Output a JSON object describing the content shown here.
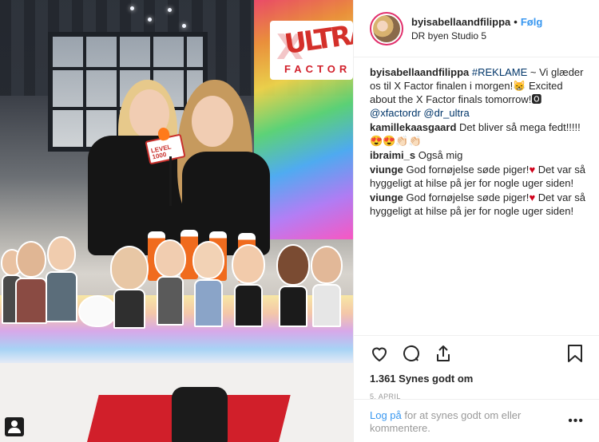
{
  "post": {
    "username": "byisabellaandfilippa",
    "separator": "•",
    "follow_label": "Følg",
    "location": "DR byen Studio 5"
  },
  "photo": {
    "banner_letters": "ULTRA",
    "banner_sub": "FACTOR",
    "sign_text": "LEVEL 1000"
  },
  "comments": [
    {
      "user": "byisabellaandfilippa",
      "parts": [
        {
          "text": " "
        },
        {
          "text": "#REKLAME",
          "link": true
        },
        {
          "text": " ~ Vi glæder os til X Factor finalen i morgen!😸 Excited about the X Factor finals tomorrow!"
        },
        {
          "text": "🅾",
          "emoji_box": true
        },
        {
          "text": " "
        },
        {
          "text": "@xfactordr",
          "link": true
        },
        {
          "text": " "
        },
        {
          "text": "@dr_ultra",
          "link": true
        }
      ]
    },
    {
      "user": "kamillekaasgaard",
      "parts": [
        {
          "text": " Det bliver så mega fedt!!!!! "
        },
        {
          "text": "😍😍👏🏻👏🏻",
          "emojis": true
        }
      ]
    },
    {
      "user": "ibraimi_s",
      "parts": [
        {
          "text": " Også mig"
        }
      ]
    },
    {
      "user": "viunge",
      "parts": [
        {
          "text": " God fornøjelse søde piger!"
        },
        {
          "text": "♥",
          "heart": true
        },
        {
          "text": " Det var så hyggeligt at hilse på jer for nogle uger siden!"
        }
      ]
    },
    {
      "user": "viunge",
      "parts": [
        {
          "text": " God fornøjelse søde piger!"
        },
        {
          "text": "♥",
          "heart": true
        },
        {
          "text": " Det var så hyggeligt at hilse på jer for nogle uger siden!"
        }
      ]
    }
  ],
  "actions": {
    "icons": [
      "heart-icon",
      "comment-icon",
      "share-icon",
      "bookmark-icon"
    ],
    "likes_text": "1.361 Synes godt om",
    "date": "5. APRIL"
  },
  "footer": {
    "login_link": "Log på",
    "rest": " for at synes godt om eller kommentere.",
    "more": "•••"
  },
  "colors": {
    "link": "#003569",
    "follow": "#3897f0",
    "heart": "#d0021b",
    "muted": "#999999"
  }
}
